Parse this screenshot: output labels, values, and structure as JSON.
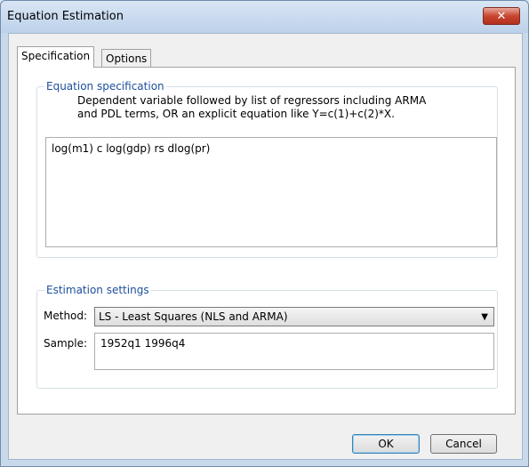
{
  "window": {
    "title": "Equation Estimation",
    "close_label": "✕"
  },
  "tabs": [
    {
      "label": "Specification"
    },
    {
      "label": "Options"
    }
  ],
  "spec": {
    "legend": "Equation specification",
    "description_line1": "Dependent variable followed by list of regressors including ARMA",
    "description_line2": "and PDL terms, OR an explicit equation like Y=c(1)+c(2)*X.",
    "equation": "log(m1) c log(gdp) rs dlog(pr)"
  },
  "settings": {
    "legend": "Estimation settings",
    "method_label": "Method:",
    "method_value": "LS  -  Least Squares (NLS and ARMA)",
    "sample_label": "Sample:",
    "sample_value": "1952q1 1996q4"
  },
  "buttons": {
    "ok": "OK",
    "cancel": "Cancel"
  }
}
